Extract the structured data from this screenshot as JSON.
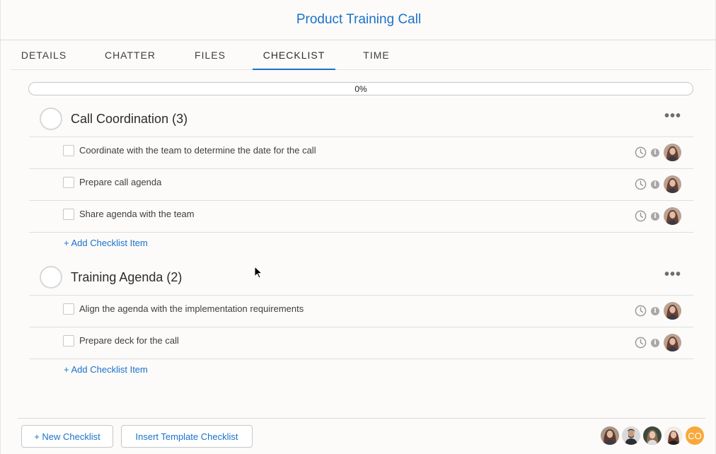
{
  "header": {
    "title": "Product Training Call"
  },
  "tabs": [
    {
      "label": "DETAILS"
    },
    {
      "label": "CHATTER"
    },
    {
      "label": "FILES"
    },
    {
      "label": "CHECKLIST"
    },
    {
      "label": "TIME"
    }
  ],
  "active_tab": "CHECKLIST",
  "progress": {
    "label": "0%",
    "value": 0
  },
  "groups": [
    {
      "title": "Call Coordination (3)",
      "more_label": "•••",
      "items": [
        {
          "text": "Coordinate with the team to determine the date for the call"
        },
        {
          "text": "Prepare call agenda"
        },
        {
          "text": "Share agenda with the team"
        }
      ],
      "add_label": "+ Add Checklist Item"
    },
    {
      "title": "Training Agenda (2)",
      "more_label": "•••",
      "items": [
        {
          "text": "Align the agenda with the implementation requirements"
        },
        {
          "text": "Prepare deck for the call"
        }
      ],
      "add_label": "+ Add Checklist Item"
    }
  ],
  "footer": {
    "new_checklist_label": "+ New Checklist",
    "insert_template_label": "Insert Template Checklist",
    "co_initials": "CO"
  },
  "icons": {
    "clock": "clock-icon",
    "info": "info-icon",
    "more": "more-icon",
    "avatar": "avatar"
  },
  "colors": {
    "accent": "#1b72c9",
    "co_avatar": "#f9a83a",
    "progress_fill": "#4bca81"
  },
  "info_glyph": "i"
}
